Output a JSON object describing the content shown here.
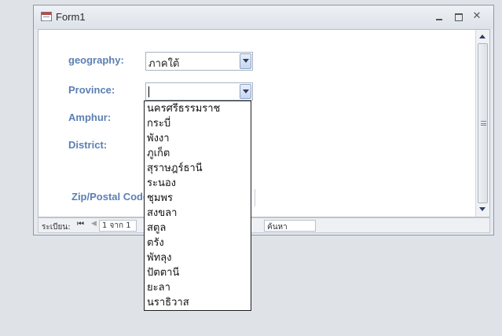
{
  "window": {
    "title": "Form1"
  },
  "form": {
    "geography": {
      "label": "geography:",
      "value": "ภาคใต้"
    },
    "province": {
      "label": "Province:",
      "value": ""
    },
    "amphur": {
      "label": "Amphur:"
    },
    "district": {
      "label": "District:"
    },
    "zip": {
      "label": "Zip/Postal Code"
    }
  },
  "dropdown": {
    "options": [
      "นครศรีธรรมราช",
      "กระบี่",
      "พังงา",
      "ภูเก็ต",
      "สุราษฎร์ธานี",
      "ระนอง",
      "ชุมพร",
      "สงขลา",
      "สตูล",
      "ตรัง",
      "พัทลุง",
      "ปัตตานี",
      "ยะลา",
      "นราธิวาส"
    ]
  },
  "navbar": {
    "record_label": "ระเบียน:",
    "position": "1 จาก 1",
    "search_text": "ค้นหา"
  },
  "icons": {
    "first": "first-record-icon",
    "prev": "previous-record-icon",
    "minimize": "minimize-icon",
    "restore": "restore-icon",
    "close": "close-icon"
  }
}
